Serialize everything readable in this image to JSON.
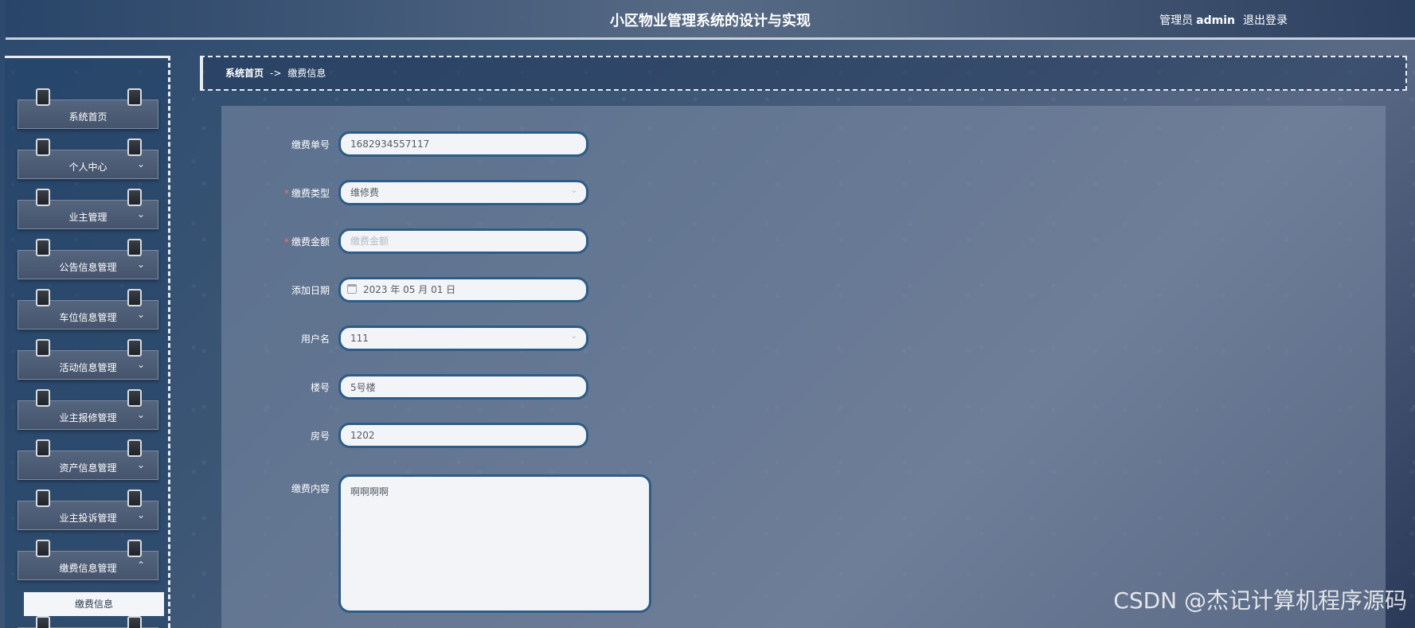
{
  "header": {
    "title": "小区物业管理系统的设计与实现",
    "role": "管理员",
    "username": "admin",
    "logout": "退出登录"
  },
  "sidebar": {
    "items": [
      {
        "label": "系统首页",
        "has_chevron": false
      },
      {
        "label": "个人中心",
        "chevron": "⌄"
      },
      {
        "label": "业主管理",
        "chevron": "⌄"
      },
      {
        "label": "公告信息管理",
        "chevron": "⌄"
      },
      {
        "label": "车位信息管理",
        "chevron": "⌄"
      },
      {
        "label": "活动信息管理",
        "chevron": "⌄"
      },
      {
        "label": "业主报修管理",
        "chevron": "⌄"
      },
      {
        "label": "资产信息管理",
        "chevron": "⌄"
      },
      {
        "label": "业主投诉管理",
        "chevron": "⌄"
      },
      {
        "label": "缴费信息管理",
        "chevron": "⌃"
      }
    ],
    "sub_item": "缴费信息"
  },
  "breadcrumb": {
    "home": "系统首页",
    "sep": "->",
    "current": "缴费信息"
  },
  "form": {
    "order_no": {
      "label": "缴费单号",
      "value": "1682934557117"
    },
    "fee_type": {
      "label": "缴费类型",
      "value": "维修费",
      "required": true
    },
    "amount": {
      "label": "缴费金额",
      "placeholder": "缴费金额",
      "required": true
    },
    "date": {
      "label": "添加日期",
      "value": "2023 年 05 月 01 日"
    },
    "username": {
      "label": "用户名",
      "value": "111"
    },
    "building": {
      "label": "楼号",
      "value": "5号楼"
    },
    "room": {
      "label": "房号",
      "value": "1202"
    },
    "content": {
      "label": "缴费内容",
      "value": "啊啊啊啊"
    }
  },
  "watermark": "CSDN @杰记计算机程序源码",
  "colors": {
    "input_border": "#2d5c86",
    "required_mark": "#ff6b6b"
  }
}
